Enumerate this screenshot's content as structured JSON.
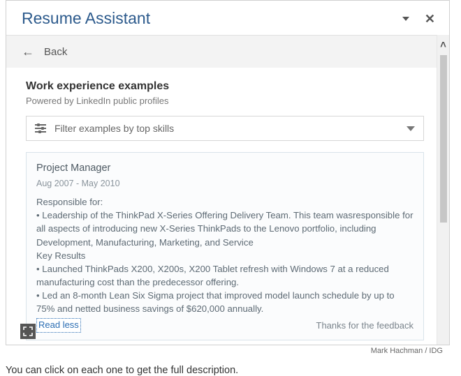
{
  "header": {
    "title": "Resume Assistant"
  },
  "nav": {
    "back_label": "Back"
  },
  "section": {
    "title": "Work experience examples",
    "subtitle": "Powered by LinkedIn public profiles"
  },
  "filter": {
    "label": "Filter examples by top skills"
  },
  "example": {
    "job_title": "Project Manager",
    "dates": "Aug 2007 - May 2010",
    "description": "Responsible for:\n• Leadership of the ThinkPad X-Series Offering Delivery Team. This team wasresponsible for all aspects of introducing new X-Series ThinkPads to the Lenovo portfolio, including Development, Manufacturing, Marketing, and Service\nKey Results\n• Launched ThinkPads X200, X200s, X200 Tablet refresh with Windows 7 at a reduced manufacturing cost than the predecessor offering.\n• Led an 8-month Lean Six Sigma project that improved model launch schedule by up to 75% and netted business savings of $620,000 annually.",
    "toggle_label": "Read less",
    "feedback_label": "Thanks for the feedback"
  },
  "credit": "Mark Hachman / IDG",
  "caption": "You can click on each one to get the full description."
}
